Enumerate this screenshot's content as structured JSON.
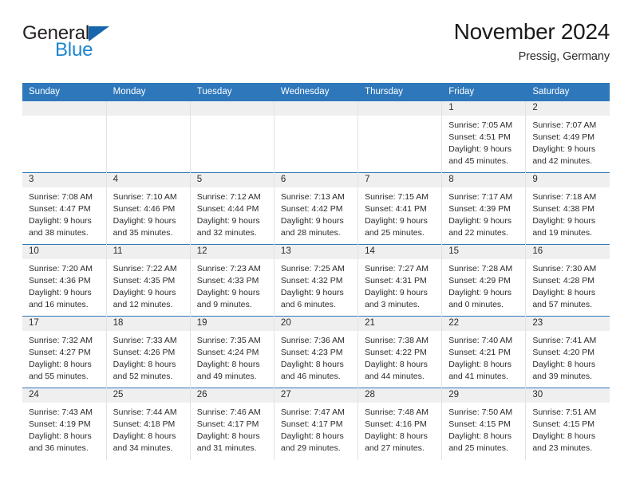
{
  "brand": {
    "logo_text_1": "General",
    "logo_text_2": "Blue",
    "triangle_icon": "triangle-icon",
    "accent_color": "#1d86d0",
    "header_color": "#2e77bb"
  },
  "header": {
    "title": "November 2024",
    "subtitle": "Pressig, Germany"
  },
  "calendar": {
    "weekday_headers": [
      "Sunday",
      "Monday",
      "Tuesday",
      "Wednesday",
      "Thursday",
      "Friday",
      "Saturday"
    ],
    "labels": {
      "sunrise": "Sunrise:",
      "sunset": "Sunset:",
      "daylight": "Daylight:"
    },
    "weeks": [
      [
        {
          "empty": true
        },
        {
          "empty": true
        },
        {
          "empty": true
        },
        {
          "empty": true
        },
        {
          "empty": true
        },
        {
          "day": "1",
          "sunrise": "Sunrise: 7:05 AM",
          "sunset": "Sunset: 4:51 PM",
          "daylight_1": "Daylight: 9 hours",
          "daylight_2": "and 45 minutes."
        },
        {
          "day": "2",
          "sunrise": "Sunrise: 7:07 AM",
          "sunset": "Sunset: 4:49 PM",
          "daylight_1": "Daylight: 9 hours",
          "daylight_2": "and 42 minutes."
        }
      ],
      [
        {
          "day": "3",
          "sunrise": "Sunrise: 7:08 AM",
          "sunset": "Sunset: 4:47 PM",
          "daylight_1": "Daylight: 9 hours",
          "daylight_2": "and 38 minutes."
        },
        {
          "day": "4",
          "sunrise": "Sunrise: 7:10 AM",
          "sunset": "Sunset: 4:46 PM",
          "daylight_1": "Daylight: 9 hours",
          "daylight_2": "and 35 minutes."
        },
        {
          "day": "5",
          "sunrise": "Sunrise: 7:12 AM",
          "sunset": "Sunset: 4:44 PM",
          "daylight_1": "Daylight: 9 hours",
          "daylight_2": "and 32 minutes."
        },
        {
          "day": "6",
          "sunrise": "Sunrise: 7:13 AM",
          "sunset": "Sunset: 4:42 PM",
          "daylight_1": "Daylight: 9 hours",
          "daylight_2": "and 28 minutes."
        },
        {
          "day": "7",
          "sunrise": "Sunrise: 7:15 AM",
          "sunset": "Sunset: 4:41 PM",
          "daylight_1": "Daylight: 9 hours",
          "daylight_2": "and 25 minutes."
        },
        {
          "day": "8",
          "sunrise": "Sunrise: 7:17 AM",
          "sunset": "Sunset: 4:39 PM",
          "daylight_1": "Daylight: 9 hours",
          "daylight_2": "and 22 minutes."
        },
        {
          "day": "9",
          "sunrise": "Sunrise: 7:18 AM",
          "sunset": "Sunset: 4:38 PM",
          "daylight_1": "Daylight: 9 hours",
          "daylight_2": "and 19 minutes."
        }
      ],
      [
        {
          "day": "10",
          "sunrise": "Sunrise: 7:20 AM",
          "sunset": "Sunset: 4:36 PM",
          "daylight_1": "Daylight: 9 hours",
          "daylight_2": "and 16 minutes."
        },
        {
          "day": "11",
          "sunrise": "Sunrise: 7:22 AM",
          "sunset": "Sunset: 4:35 PM",
          "daylight_1": "Daylight: 9 hours",
          "daylight_2": "and 12 minutes."
        },
        {
          "day": "12",
          "sunrise": "Sunrise: 7:23 AM",
          "sunset": "Sunset: 4:33 PM",
          "daylight_1": "Daylight: 9 hours",
          "daylight_2": "and 9 minutes."
        },
        {
          "day": "13",
          "sunrise": "Sunrise: 7:25 AM",
          "sunset": "Sunset: 4:32 PM",
          "daylight_1": "Daylight: 9 hours",
          "daylight_2": "and 6 minutes."
        },
        {
          "day": "14",
          "sunrise": "Sunrise: 7:27 AM",
          "sunset": "Sunset: 4:31 PM",
          "daylight_1": "Daylight: 9 hours",
          "daylight_2": "and 3 minutes."
        },
        {
          "day": "15",
          "sunrise": "Sunrise: 7:28 AM",
          "sunset": "Sunset: 4:29 PM",
          "daylight_1": "Daylight: 9 hours",
          "daylight_2": "and 0 minutes."
        },
        {
          "day": "16",
          "sunrise": "Sunrise: 7:30 AM",
          "sunset": "Sunset: 4:28 PM",
          "daylight_1": "Daylight: 8 hours",
          "daylight_2": "and 57 minutes."
        }
      ],
      [
        {
          "day": "17",
          "sunrise": "Sunrise: 7:32 AM",
          "sunset": "Sunset: 4:27 PM",
          "daylight_1": "Daylight: 8 hours",
          "daylight_2": "and 55 minutes."
        },
        {
          "day": "18",
          "sunrise": "Sunrise: 7:33 AM",
          "sunset": "Sunset: 4:26 PM",
          "daylight_1": "Daylight: 8 hours",
          "daylight_2": "and 52 minutes."
        },
        {
          "day": "19",
          "sunrise": "Sunrise: 7:35 AM",
          "sunset": "Sunset: 4:24 PM",
          "daylight_1": "Daylight: 8 hours",
          "daylight_2": "and 49 minutes."
        },
        {
          "day": "20",
          "sunrise": "Sunrise: 7:36 AM",
          "sunset": "Sunset: 4:23 PM",
          "daylight_1": "Daylight: 8 hours",
          "daylight_2": "and 46 minutes."
        },
        {
          "day": "21",
          "sunrise": "Sunrise: 7:38 AM",
          "sunset": "Sunset: 4:22 PM",
          "daylight_1": "Daylight: 8 hours",
          "daylight_2": "and 44 minutes."
        },
        {
          "day": "22",
          "sunrise": "Sunrise: 7:40 AM",
          "sunset": "Sunset: 4:21 PM",
          "daylight_1": "Daylight: 8 hours",
          "daylight_2": "and 41 minutes."
        },
        {
          "day": "23",
          "sunrise": "Sunrise: 7:41 AM",
          "sunset": "Sunset: 4:20 PM",
          "daylight_1": "Daylight: 8 hours",
          "daylight_2": "and 39 minutes."
        }
      ],
      [
        {
          "day": "24",
          "sunrise": "Sunrise: 7:43 AM",
          "sunset": "Sunset: 4:19 PM",
          "daylight_1": "Daylight: 8 hours",
          "daylight_2": "and 36 minutes."
        },
        {
          "day": "25",
          "sunrise": "Sunrise: 7:44 AM",
          "sunset": "Sunset: 4:18 PM",
          "daylight_1": "Daylight: 8 hours",
          "daylight_2": "and 34 minutes."
        },
        {
          "day": "26",
          "sunrise": "Sunrise: 7:46 AM",
          "sunset": "Sunset: 4:17 PM",
          "daylight_1": "Daylight: 8 hours",
          "daylight_2": "and 31 minutes."
        },
        {
          "day": "27",
          "sunrise": "Sunrise: 7:47 AM",
          "sunset": "Sunset: 4:17 PM",
          "daylight_1": "Daylight: 8 hours",
          "daylight_2": "and 29 minutes."
        },
        {
          "day": "28",
          "sunrise": "Sunrise: 7:48 AM",
          "sunset": "Sunset: 4:16 PM",
          "daylight_1": "Daylight: 8 hours",
          "daylight_2": "and 27 minutes."
        },
        {
          "day": "29",
          "sunrise": "Sunrise: 7:50 AM",
          "sunset": "Sunset: 4:15 PM",
          "daylight_1": "Daylight: 8 hours",
          "daylight_2": "and 25 minutes."
        },
        {
          "day": "30",
          "sunrise": "Sunrise: 7:51 AM",
          "sunset": "Sunset: 4:15 PM",
          "daylight_1": "Daylight: 8 hours",
          "daylight_2": "and 23 minutes."
        }
      ]
    ]
  }
}
